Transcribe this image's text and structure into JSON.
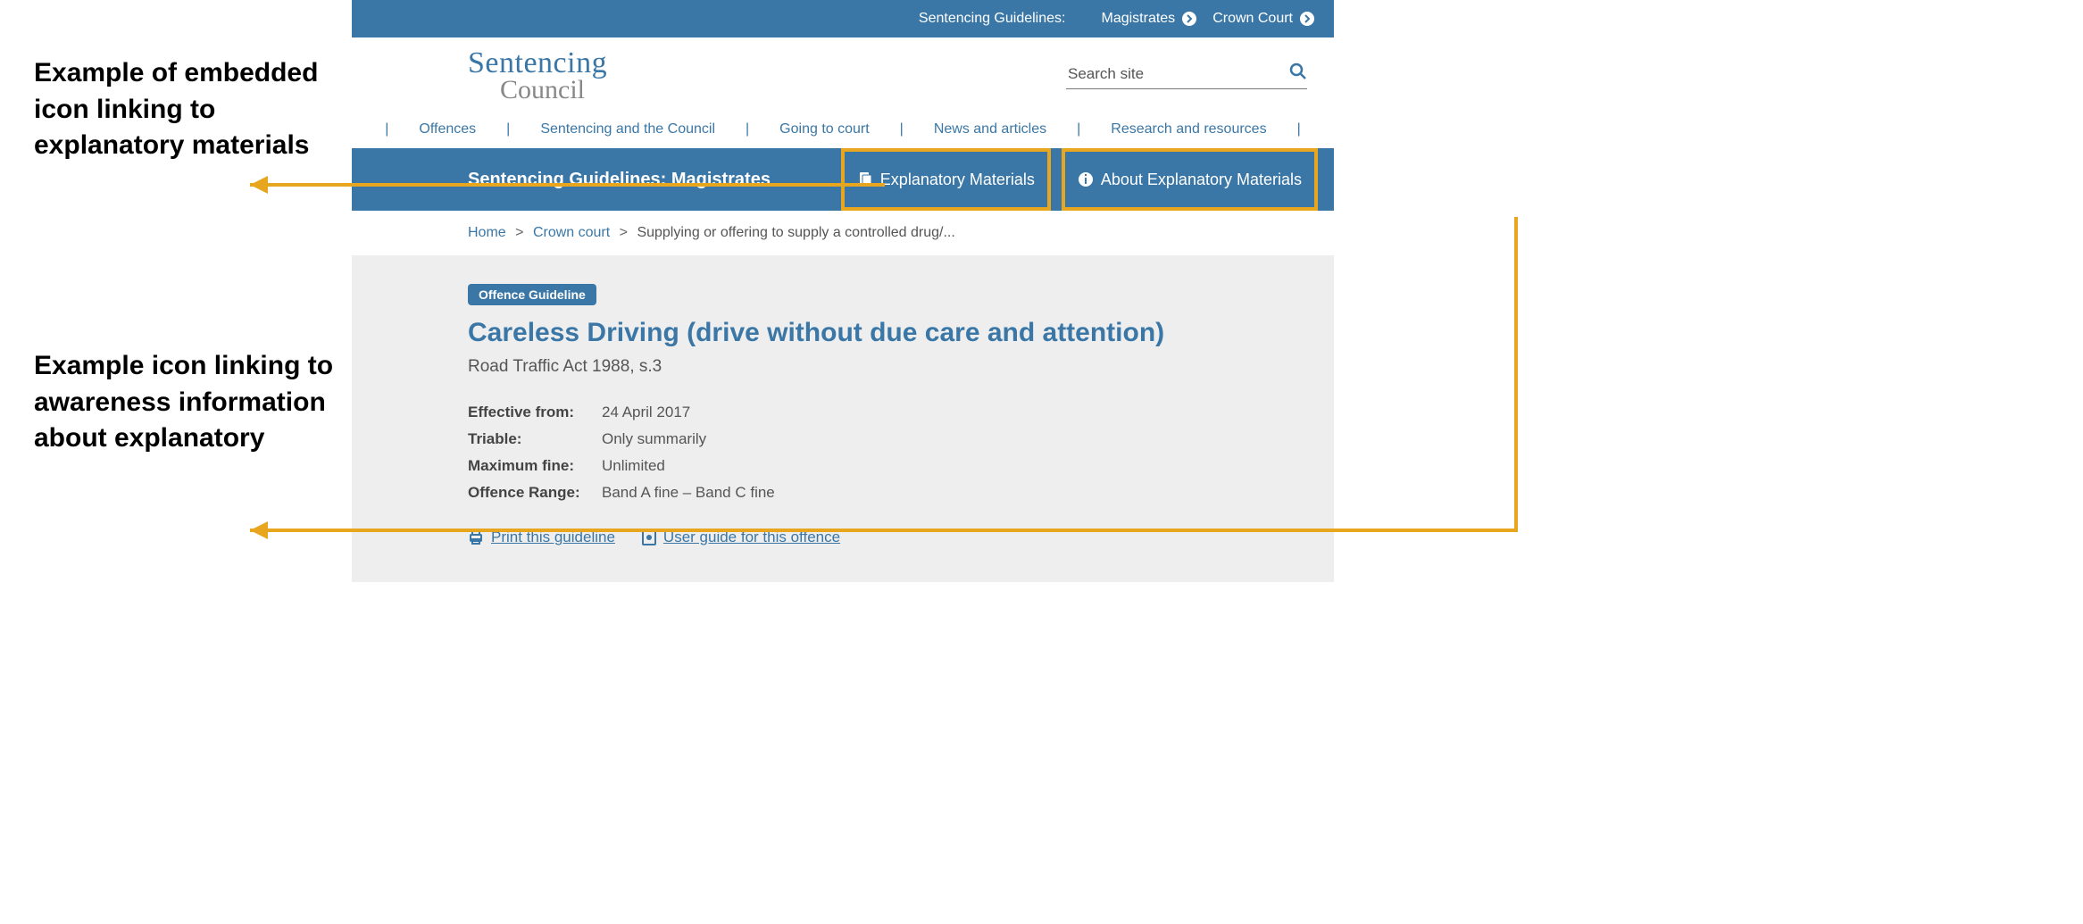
{
  "annotations": {
    "a1": "Example of embedded icon linking to explanatory materials",
    "a2": "Example icon linking to awareness information about explanatory"
  },
  "topbar": {
    "label": "Sentencing Guidelines:",
    "link1": "Magistrates",
    "link2": "Crown Court"
  },
  "logo": {
    "line1": "Sentencing",
    "line2": "Council"
  },
  "search": {
    "placeholder": "Search site"
  },
  "nav": {
    "offences": "Offences",
    "sac": "Sentencing and the Council",
    "court": "Going to court",
    "news": "News and articles",
    "research": "Research and resources"
  },
  "bluebar": {
    "title": "Sentencing Guidelines: Magistrates",
    "explanatory": "Explanatory Materials",
    "about": "About Explanatory Materials"
  },
  "breadcrumb": {
    "home": "Home",
    "crown": "Crown court",
    "current": "Supplying or offering to supply a controlled drug/..."
  },
  "content": {
    "pill": "Offence Guideline",
    "title": "Careless Driving (drive without due care and attention)",
    "act": "Road Traffic Act 1988, s.3",
    "kv": {
      "effective_k": "Effective from:",
      "effective_v": "24 April 2017",
      "triable_k": "Triable:",
      "triable_v": "Only summarily",
      "maxfine_k": "Maximum fine:",
      "maxfine_v": "Unlimited",
      "range_k": "Offence Range:",
      "range_v": "Band A fine – Band C fine"
    },
    "links": {
      "print": "Print this guideline",
      "guide": "User guide for this offence"
    }
  }
}
